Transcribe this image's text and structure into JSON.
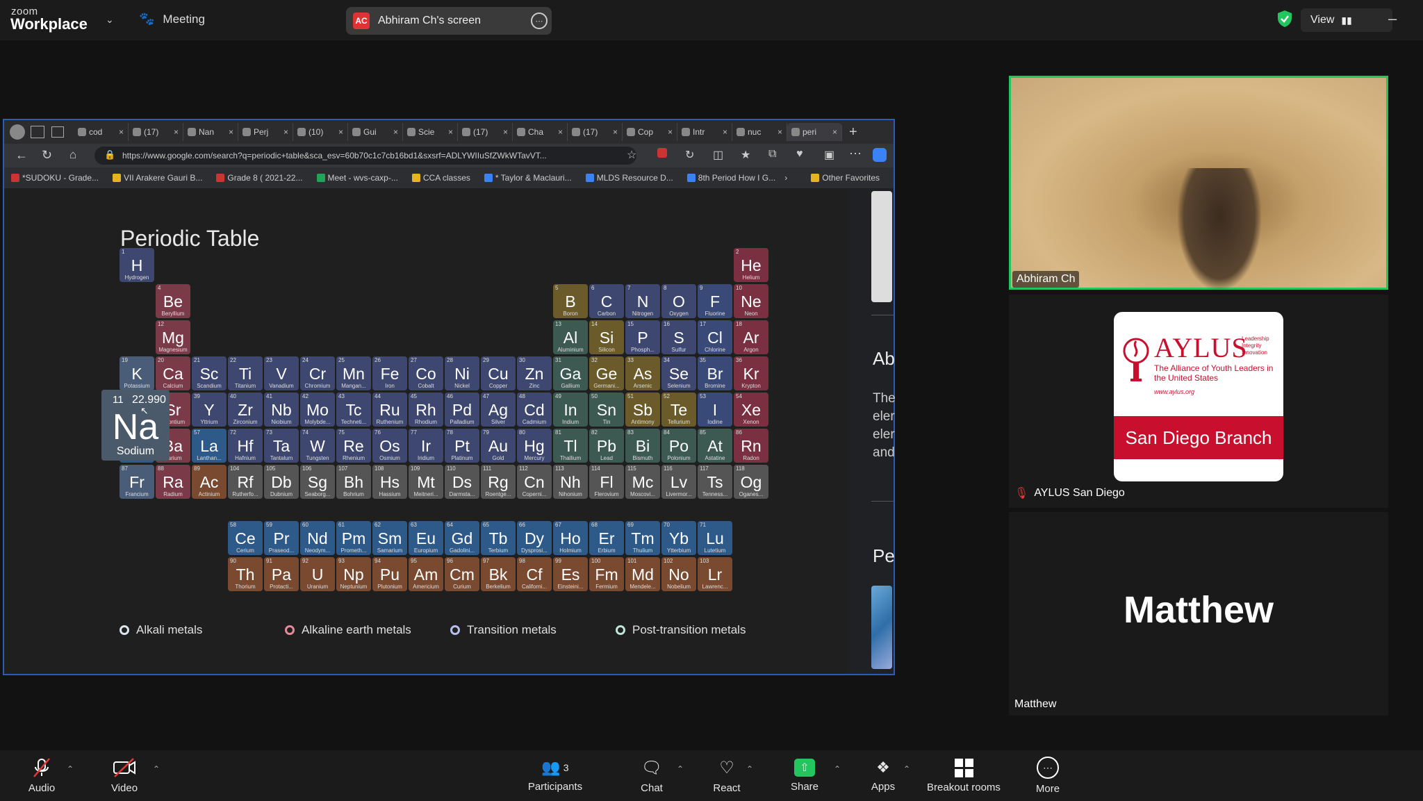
{
  "topbar": {
    "zoom_word": "zoom",
    "app_name": "Workplace",
    "meeting_label": "Meeting",
    "screen_badge": "AC",
    "screen_label": "Abhiram Ch's screen",
    "view_label": "View"
  },
  "browser": {
    "tabs": [
      "cod",
      "(17)",
      "Nan",
      "Perj",
      "(10)",
      "Gui",
      "Scie",
      "(17)",
      "Cha",
      "(17)",
      "Cop",
      "Intr",
      "nuc",
      "peri"
    ],
    "url": "https://www.google.com/search?q=periodic+table&sca_esv=60b70c1c7cb16bd1&sxsrf=ADLYWIIuSfZWkWTavVT...",
    "favorites": [
      "*SUDOKU - Grade...",
      "VII Arakere Gauri B...",
      "Grade 8 ( 2021-22...",
      "Meet - wvs-caxp-...",
      "CCA classes",
      "* Taylor & Maclauri...",
      "MLDS Resource D...",
      "8th Period How I G..."
    ],
    "other_favorites": "Other Favorites"
  },
  "periodic": {
    "title": "Periodic Table",
    "tooltip": {
      "num": "11",
      "mass": "22.990",
      "sym": "Na",
      "name": "Sodium"
    },
    "legend": [
      "Alkali metals",
      "Alkaline earth metals",
      "Transition metals",
      "Post-transition metals"
    ],
    "side_text": {
      "ab": "Ab",
      "lines": [
        "The",
        "eler",
        "eler",
        "and"
      ],
      "pe": "Pe"
    }
  },
  "colors": {
    "alkali": "#4a5d78",
    "alkaline": "#7a3a48",
    "transition": "#3d4770",
    "post": "#3d5a52",
    "metalloid": "#6b5a2a",
    "nonmetal": "#3d4770",
    "halogen": "#3a4a78",
    "noble": "#7a3040",
    "lanthanide": "#2e5a8a",
    "actinide": "#7a4a30",
    "unknown": "#555555",
    "active_speaker": "#22c55e",
    "brand_red": "#c8102e"
  },
  "participants": {
    "cam_name": "Abhiram Ch",
    "aylus_name": "AYLUS San Diego",
    "aylus_logo_word": "AYLUS",
    "aylus_tagline": "The Alliance of Youth Leaders in the United States",
    "aylus_url": "www.aylus.org",
    "aylus_side": "Leadership Integrity Innovation",
    "aylus_branch": "San Diego Branch",
    "matthew_big": "Matthew",
    "matthew_tag": "Matthew"
  },
  "toolbar": {
    "audio": "Audio",
    "video": "Video",
    "participants": "Participants",
    "participants_count": "3",
    "chat": "Chat",
    "react": "React",
    "share": "Share",
    "apps": "Apps",
    "breakout": "Breakout rooms",
    "more": "More"
  }
}
